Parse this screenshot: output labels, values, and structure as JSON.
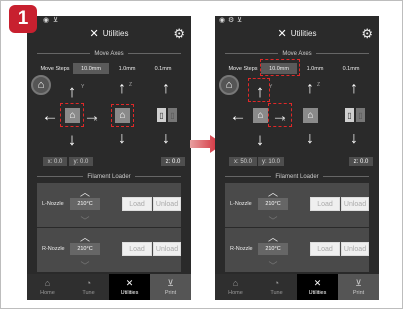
{
  "step_badge": "1",
  "screens": [
    {
      "title": "Utilities",
      "move_axes_label": "Move Axes",
      "move_steps_label": "Move Steps",
      "steps": [
        "10.0mm",
        "1.0mm",
        "0.1mm"
      ],
      "active_step": "10.0mm",
      "axis_labels": {
        "y": "Y",
        "x": "X",
        "z": "Z"
      },
      "coords": {
        "x": "x: 0.0",
        "y": "y: 0.0",
        "z": "z: 0.0"
      },
      "filament_loader_label": "Filament Loader",
      "nozzles": [
        {
          "name": "L-Nozzle",
          "temp": "210°C",
          "load": "Load",
          "unload": "Unload"
        },
        {
          "name": "R-Nozzle",
          "temp": "210°C",
          "load": "Load",
          "unload": "Unload"
        }
      ],
      "tabs": [
        "Home",
        "Tune",
        "Utilities",
        "Print"
      ]
    },
    {
      "title": "Utilities",
      "move_axes_label": "Move Axes",
      "move_steps_label": "Move Steps",
      "steps": [
        "10.0mm",
        "1.0mm",
        "0.1mm"
      ],
      "active_step": "10.0mm",
      "axis_labels": {
        "y": "Y",
        "x": "X",
        "z": "Z"
      },
      "coords": {
        "x": "x: 50.0",
        "y": "y: 10.0",
        "z": "z: 0.0"
      },
      "filament_loader_label": "Filament Loader",
      "nozzles": [
        {
          "name": "L-Nozzle",
          "temp": "210°C",
          "load": "Load",
          "unload": "Unload"
        },
        {
          "name": "R-Nozzle",
          "temp": "210°C",
          "load": "Load",
          "unload": "Unload"
        }
      ],
      "tabs": [
        "Home",
        "Tune",
        "Utilities",
        "Print"
      ]
    }
  ],
  "colors": {
    "accent": "#c8202f",
    "highlight": "#e02828",
    "background": "#2a2a2a"
  },
  "icons": [
    "wifi-icon",
    "usb-icon",
    "tools-icon",
    "gear-icon",
    "home-icon",
    "arrow-up-icon",
    "arrow-down-icon",
    "arrow-left-icon",
    "arrow-right-icon",
    "nozzle-icon",
    "chevron-up-icon",
    "chevron-down-icon",
    "tune-icon",
    "print-icon"
  ]
}
